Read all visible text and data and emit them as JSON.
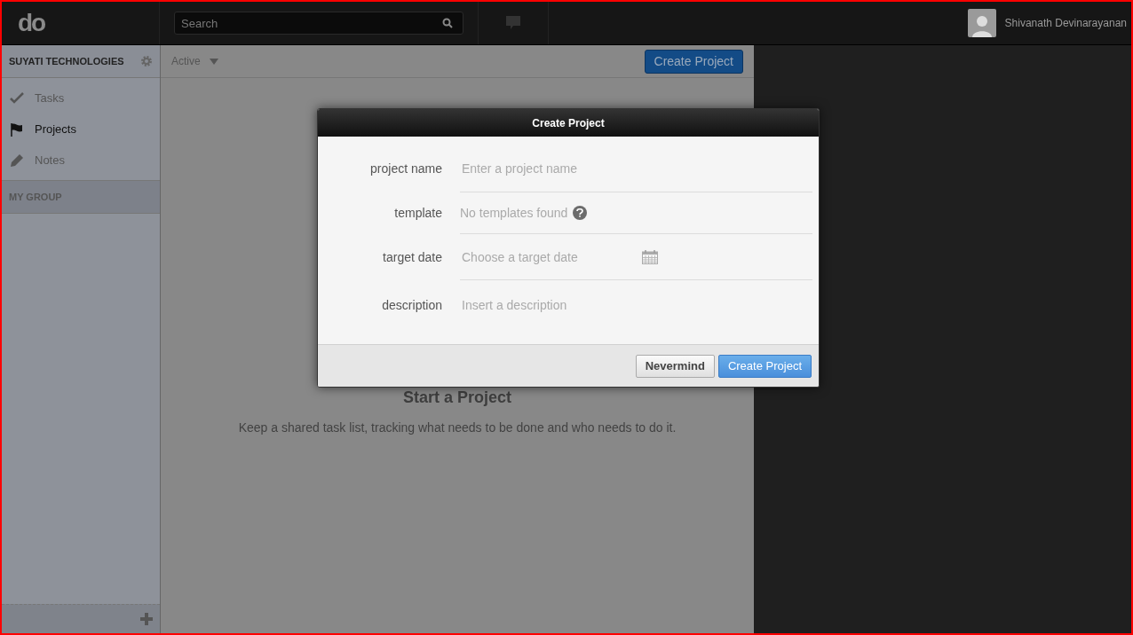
{
  "header": {
    "logo": "do",
    "search": {
      "placeholder": "Search"
    },
    "user": "Shivanath Devinarayanan"
  },
  "sidebar": {
    "organization": "SUYATI TECHNOLOGIES",
    "items": [
      {
        "label": "Tasks",
        "selected": false
      },
      {
        "label": "Projects",
        "selected": true
      },
      {
        "label": "Notes",
        "selected": false
      }
    ],
    "group": "MY GROUP"
  },
  "toolbar": {
    "filter": "Active",
    "button": "Create Project"
  },
  "empty_state": {
    "title": "Start a Project",
    "text": "Keep a shared task list, tracking what needs to be done and who needs to do it."
  },
  "dialog": {
    "title": "Create Project",
    "fields": [
      {
        "kind": "input",
        "label": "project name",
        "placeholder": "Enter a project name"
      },
      {
        "kind": "info",
        "label": "template",
        "value": "No templates found"
      },
      {
        "kind": "date",
        "label": "target date",
        "placeholder": "Choose a target date"
      },
      {
        "kind": "textarea",
        "label": "description",
        "placeholder": "Insert a description"
      }
    ],
    "buttons": [
      {
        "label": "Nevermind",
        "kind": "secondary"
      },
      {
        "label": "Create Project",
        "kind": "primary"
      }
    ]
  }
}
